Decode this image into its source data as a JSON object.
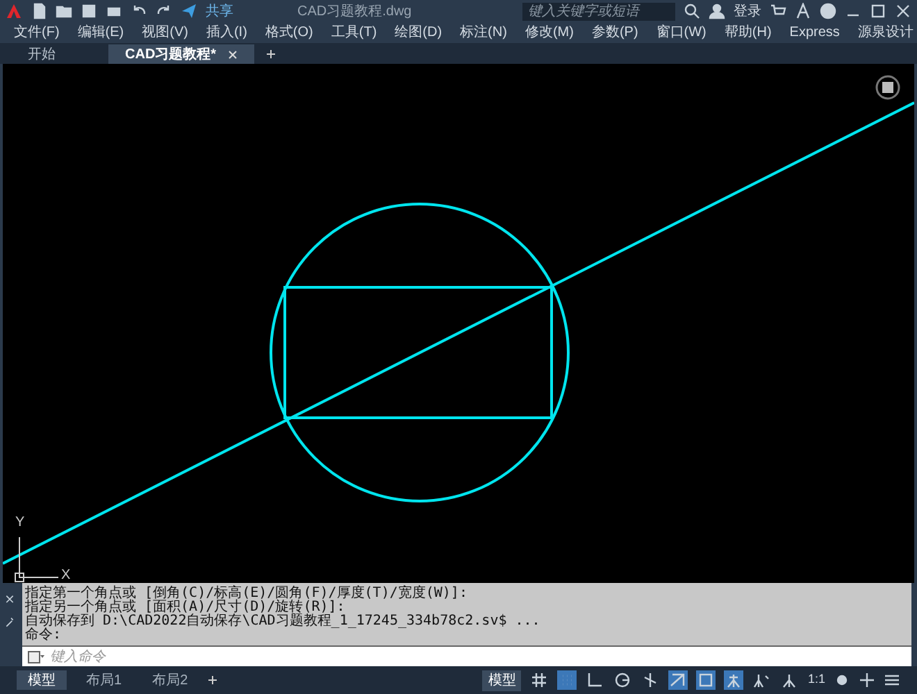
{
  "title_bar": {
    "share": "共享",
    "title": "CAD习题教程.dwg",
    "search": {
      "placeholder": "键入关键字或短语"
    },
    "login": "登录"
  },
  "menu": [
    "文件(F)",
    "编辑(E)",
    "视图(V)",
    "插入(I)",
    "格式(O)",
    "工具(T)",
    "绘图(D)",
    "标注(N)",
    "修改(M)",
    "参数(P)",
    "窗口(W)",
    "帮助(H)",
    "Express",
    "源泉设计"
  ],
  "tabs": [
    {
      "label": "开始",
      "selected": false
    },
    {
      "label": "CAD习题教程*",
      "selected": true
    }
  ],
  "ucs": {
    "x": "X",
    "y": "Y"
  },
  "command_history": [
    "指定第一个角点或 [倒角(C)/标高(E)/圆角(F)/厚度(T)/宽度(W)]:",
    "指定另一个角点或 [面积(A)/尺寸(D)/旋转(R)]:",
    "自动保存到 D:\\CAD2022自动保存\\CAD习题教程_1_17245_334b78c2.sv$ ...",
    "命令:"
  ],
  "command_input": {
    "placeholder": "键入命令"
  },
  "layout_tabs": [
    {
      "label": "模型",
      "selected": true
    },
    {
      "label": "布局1",
      "selected": false
    },
    {
      "label": "布局2",
      "selected": false
    }
  ],
  "status_bar": {
    "space": "模型",
    "scale": "1:1",
    "toggles": [
      {
        "kind": "grid",
        "on": false
      },
      {
        "kind": "snap",
        "on": true
      },
      {
        "kind": "ortho",
        "on": false
      },
      {
        "kind": "polar",
        "on": false
      },
      {
        "kind": "isodraft",
        "on": false
      },
      {
        "kind": "tracking",
        "on": true
      },
      {
        "kind": "osnap",
        "on": true
      },
      {
        "kind": "annovis",
        "on": true
      },
      {
        "kind": "autoscale",
        "on": false
      },
      {
        "kind": "annoscale",
        "on": false
      }
    ]
  }
}
